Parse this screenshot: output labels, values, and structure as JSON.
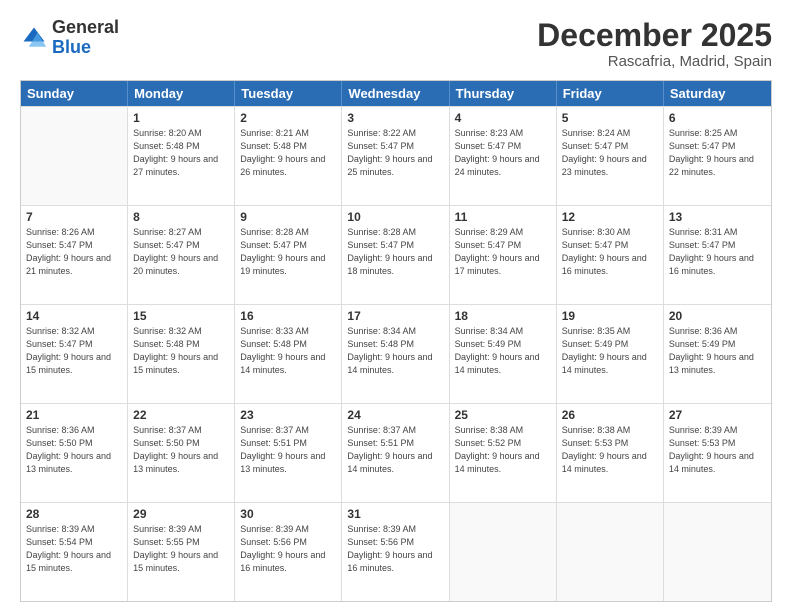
{
  "header": {
    "logo_general": "General",
    "logo_blue": "Blue",
    "month_title": "December 2025",
    "subtitle": "Rascafria, Madrid, Spain"
  },
  "days_of_week": [
    "Sunday",
    "Monday",
    "Tuesday",
    "Wednesday",
    "Thursday",
    "Friday",
    "Saturday"
  ],
  "weeks": [
    [
      {
        "day": "",
        "sunrise": "",
        "sunset": "",
        "daylight": "",
        "empty": true
      },
      {
        "day": "1",
        "sunrise": "Sunrise: 8:20 AM",
        "sunset": "Sunset: 5:48 PM",
        "daylight": "Daylight: 9 hours and 27 minutes."
      },
      {
        "day": "2",
        "sunrise": "Sunrise: 8:21 AM",
        "sunset": "Sunset: 5:48 PM",
        "daylight": "Daylight: 9 hours and 26 minutes."
      },
      {
        "day": "3",
        "sunrise": "Sunrise: 8:22 AM",
        "sunset": "Sunset: 5:47 PM",
        "daylight": "Daylight: 9 hours and 25 minutes."
      },
      {
        "day": "4",
        "sunrise": "Sunrise: 8:23 AM",
        "sunset": "Sunset: 5:47 PM",
        "daylight": "Daylight: 9 hours and 24 minutes."
      },
      {
        "day": "5",
        "sunrise": "Sunrise: 8:24 AM",
        "sunset": "Sunset: 5:47 PM",
        "daylight": "Daylight: 9 hours and 23 minutes."
      },
      {
        "day": "6",
        "sunrise": "Sunrise: 8:25 AM",
        "sunset": "Sunset: 5:47 PM",
        "daylight": "Daylight: 9 hours and 22 minutes."
      }
    ],
    [
      {
        "day": "7",
        "sunrise": "Sunrise: 8:26 AM",
        "sunset": "Sunset: 5:47 PM",
        "daylight": "Daylight: 9 hours and 21 minutes."
      },
      {
        "day": "8",
        "sunrise": "Sunrise: 8:27 AM",
        "sunset": "Sunset: 5:47 PM",
        "daylight": "Daylight: 9 hours and 20 minutes."
      },
      {
        "day": "9",
        "sunrise": "Sunrise: 8:28 AM",
        "sunset": "Sunset: 5:47 PM",
        "daylight": "Daylight: 9 hours and 19 minutes."
      },
      {
        "day": "10",
        "sunrise": "Sunrise: 8:28 AM",
        "sunset": "Sunset: 5:47 PM",
        "daylight": "Daylight: 9 hours and 18 minutes."
      },
      {
        "day": "11",
        "sunrise": "Sunrise: 8:29 AM",
        "sunset": "Sunset: 5:47 PM",
        "daylight": "Daylight: 9 hours and 17 minutes."
      },
      {
        "day": "12",
        "sunrise": "Sunrise: 8:30 AM",
        "sunset": "Sunset: 5:47 PM",
        "daylight": "Daylight: 9 hours and 16 minutes."
      },
      {
        "day": "13",
        "sunrise": "Sunrise: 8:31 AM",
        "sunset": "Sunset: 5:47 PM",
        "daylight": "Daylight: 9 hours and 16 minutes."
      }
    ],
    [
      {
        "day": "14",
        "sunrise": "Sunrise: 8:32 AM",
        "sunset": "Sunset: 5:47 PM",
        "daylight": "Daylight: 9 hours and 15 minutes."
      },
      {
        "day": "15",
        "sunrise": "Sunrise: 8:32 AM",
        "sunset": "Sunset: 5:48 PM",
        "daylight": "Daylight: 9 hours and 15 minutes."
      },
      {
        "day": "16",
        "sunrise": "Sunrise: 8:33 AM",
        "sunset": "Sunset: 5:48 PM",
        "daylight": "Daylight: 9 hours and 14 minutes."
      },
      {
        "day": "17",
        "sunrise": "Sunrise: 8:34 AM",
        "sunset": "Sunset: 5:48 PM",
        "daylight": "Daylight: 9 hours and 14 minutes."
      },
      {
        "day": "18",
        "sunrise": "Sunrise: 8:34 AM",
        "sunset": "Sunset: 5:49 PM",
        "daylight": "Daylight: 9 hours and 14 minutes."
      },
      {
        "day": "19",
        "sunrise": "Sunrise: 8:35 AM",
        "sunset": "Sunset: 5:49 PM",
        "daylight": "Daylight: 9 hours and 14 minutes."
      },
      {
        "day": "20",
        "sunrise": "Sunrise: 8:36 AM",
        "sunset": "Sunset: 5:49 PM",
        "daylight": "Daylight: 9 hours and 13 minutes."
      }
    ],
    [
      {
        "day": "21",
        "sunrise": "Sunrise: 8:36 AM",
        "sunset": "Sunset: 5:50 PM",
        "daylight": "Daylight: 9 hours and 13 minutes."
      },
      {
        "day": "22",
        "sunrise": "Sunrise: 8:37 AM",
        "sunset": "Sunset: 5:50 PM",
        "daylight": "Daylight: 9 hours and 13 minutes."
      },
      {
        "day": "23",
        "sunrise": "Sunrise: 8:37 AM",
        "sunset": "Sunset: 5:51 PM",
        "daylight": "Daylight: 9 hours and 13 minutes."
      },
      {
        "day": "24",
        "sunrise": "Sunrise: 8:37 AM",
        "sunset": "Sunset: 5:51 PM",
        "daylight": "Daylight: 9 hours and 14 minutes."
      },
      {
        "day": "25",
        "sunrise": "Sunrise: 8:38 AM",
        "sunset": "Sunset: 5:52 PM",
        "daylight": "Daylight: 9 hours and 14 minutes."
      },
      {
        "day": "26",
        "sunrise": "Sunrise: 8:38 AM",
        "sunset": "Sunset: 5:53 PM",
        "daylight": "Daylight: 9 hours and 14 minutes."
      },
      {
        "day": "27",
        "sunrise": "Sunrise: 8:39 AM",
        "sunset": "Sunset: 5:53 PM",
        "daylight": "Daylight: 9 hours and 14 minutes."
      }
    ],
    [
      {
        "day": "28",
        "sunrise": "Sunrise: 8:39 AM",
        "sunset": "Sunset: 5:54 PM",
        "daylight": "Daylight: 9 hours and 15 minutes."
      },
      {
        "day": "29",
        "sunrise": "Sunrise: 8:39 AM",
        "sunset": "Sunset: 5:55 PM",
        "daylight": "Daylight: 9 hours and 15 minutes."
      },
      {
        "day": "30",
        "sunrise": "Sunrise: 8:39 AM",
        "sunset": "Sunset: 5:56 PM",
        "daylight": "Daylight: 9 hours and 16 minutes."
      },
      {
        "day": "31",
        "sunrise": "Sunrise: 8:39 AM",
        "sunset": "Sunset: 5:56 PM",
        "daylight": "Daylight: 9 hours and 16 minutes."
      },
      {
        "day": "",
        "sunrise": "",
        "sunset": "",
        "daylight": "",
        "empty": true
      },
      {
        "day": "",
        "sunrise": "",
        "sunset": "",
        "daylight": "",
        "empty": true
      },
      {
        "day": "",
        "sunrise": "",
        "sunset": "",
        "daylight": "",
        "empty": true
      }
    ]
  ]
}
